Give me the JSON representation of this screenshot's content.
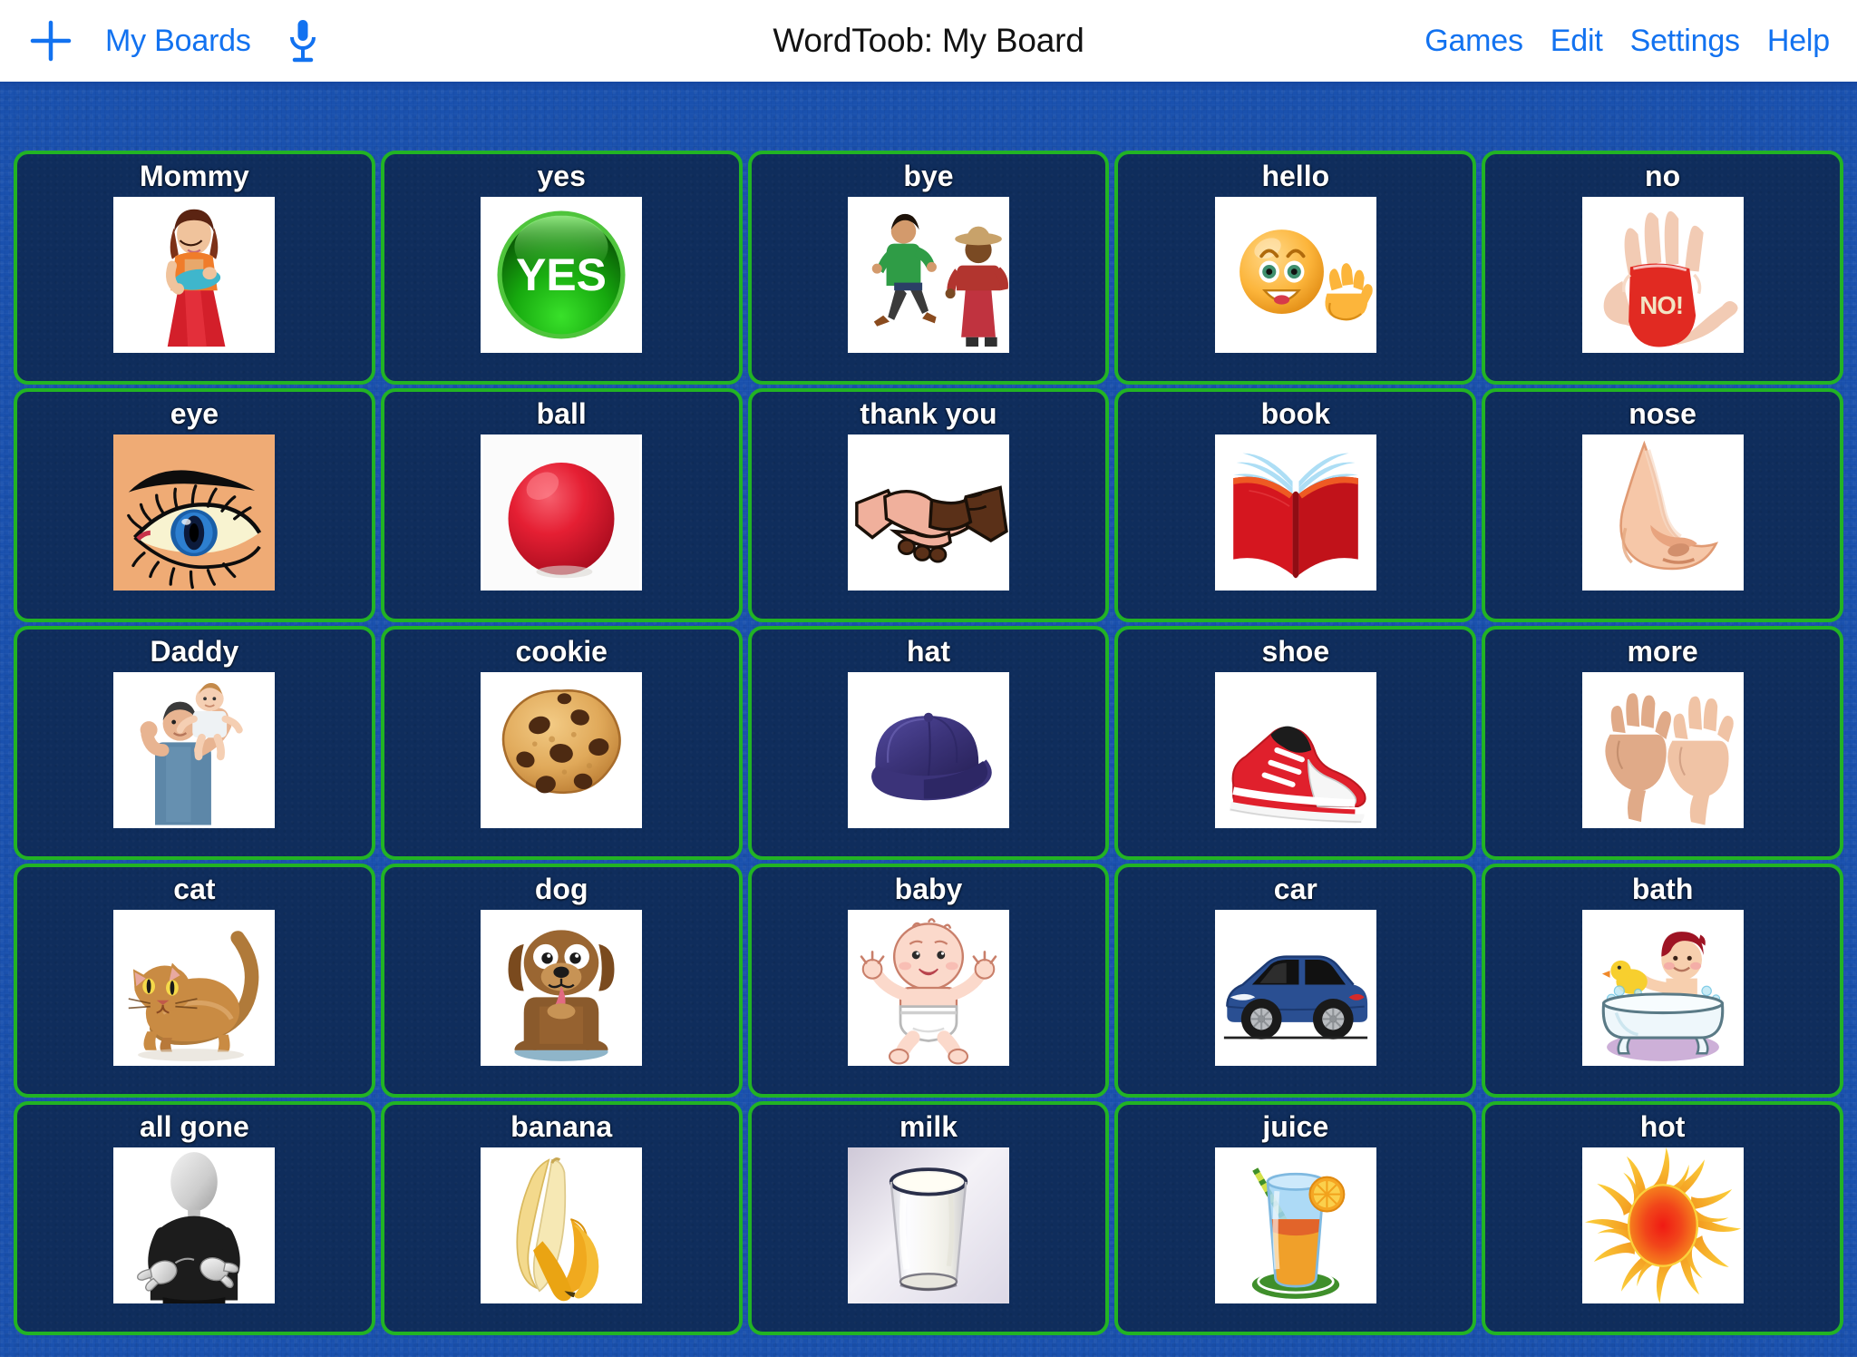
{
  "header": {
    "add_icon": "plus-icon",
    "my_boards_label": "My Boards",
    "mic_icon": "microphone-icon",
    "title": "WordToob: My Board",
    "menu": [
      {
        "label": "Games",
        "name": "games"
      },
      {
        "label": "Edit",
        "name": "edit"
      },
      {
        "label": "Settings",
        "name": "settings"
      },
      {
        "label": "Help",
        "name": "help"
      }
    ]
  },
  "colors": {
    "board_background": "#1a51ae",
    "card_background": "#0f2d5c",
    "card_border": "#22b324",
    "link": "#1272f0",
    "label_text": "#ffffff",
    "topbar_background": "#ffffff",
    "title_text": "#121212"
  },
  "board": {
    "columns": 5,
    "rows": 5,
    "cards": [
      {
        "label": "Mommy",
        "icon": "mother-holding-baby-image"
      },
      {
        "label": "yes",
        "icon": "green-yes-button-image"
      },
      {
        "label": "bye",
        "icon": "person-waving-goodbye-image"
      },
      {
        "label": "hello",
        "icon": "smiley-waving-hand-image"
      },
      {
        "label": "no",
        "icon": "red-painted-hand-no-image"
      },
      {
        "label": "eye",
        "icon": "eye-image"
      },
      {
        "label": "ball",
        "icon": "red-ball-image"
      },
      {
        "label": "thank you",
        "icon": "handshake-image"
      },
      {
        "label": "book",
        "icon": "open-red-book-image"
      },
      {
        "label": "nose",
        "icon": "nose-image"
      },
      {
        "label": "Daddy",
        "icon": "father-lifting-baby-image"
      },
      {
        "label": "cookie",
        "icon": "chocolate-chip-cookie-image"
      },
      {
        "label": "hat",
        "icon": "blue-baseball-cap-image"
      },
      {
        "label": "shoe",
        "icon": "red-sneaker-image"
      },
      {
        "label": "more",
        "icon": "two-hands-more-sign-image"
      },
      {
        "label": "cat",
        "icon": "cat-image"
      },
      {
        "label": "dog",
        "icon": "dog-image"
      },
      {
        "label": "baby",
        "icon": "baby-image"
      },
      {
        "label": "car",
        "icon": "blue-car-image"
      },
      {
        "label": "bath",
        "icon": "child-in-bathtub-image"
      },
      {
        "label": "all gone",
        "icon": "person-all-gone-sign-image"
      },
      {
        "label": "banana",
        "icon": "peeled-banana-image"
      },
      {
        "label": "milk",
        "icon": "glass-of-milk-image"
      },
      {
        "label": "juice",
        "icon": "glass-of-juice-image"
      },
      {
        "label": "hot",
        "icon": "sun-image"
      }
    ]
  }
}
